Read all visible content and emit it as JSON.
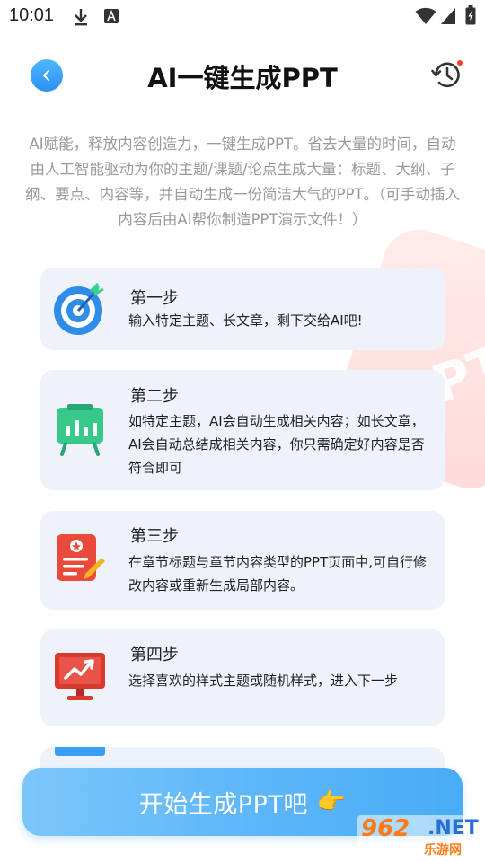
{
  "status_bar": {
    "time": "10:01",
    "download_icon": "download-icon",
    "a_icon": "font-a-icon",
    "wifi_icon": "wifi-icon",
    "signal_icon": "signal-icon",
    "battery_icon": "battery-icon"
  },
  "header": {
    "title": "AI一键生成PPT",
    "back_icon": "chevron-left-icon",
    "history_icon": "history-icon"
  },
  "intro": {
    "text": "AI赋能，释放内容创造力，一键生成PPT。省去大量的时间，自动由人工智能驱动为你的主题/课题/论点生成大量：标题、大纲、子纲、要点、内容等，并自动生成一份简洁大气的PPT。（可手动插入内容后由AI帮你制造PPT演示文件！）"
  },
  "steps": [
    {
      "title": "第一步",
      "desc": "输入特定主题、长文章，剩下交给AI吧!",
      "icon": "target-icon"
    },
    {
      "title": "第二步",
      "desc": "如特定主题，AI会自动生成相关内容；如长文章，AI会自动总结成相关内容，你只需确定好内容是否符合即可",
      "icon": "presentation-board-icon"
    },
    {
      "title": "第三步",
      "desc": "在章节标题与章节内容类型的PPT页面中,可自行修改内容或重新生成局部内容。",
      "icon": "edit-document-icon"
    },
    {
      "title": "第四步",
      "desc": "选择喜欢的样式主题或随机样式，进入下一步",
      "icon": "monitor-chart-icon"
    }
  ],
  "start_button": {
    "label": "开始生成PPT吧",
    "emoji": "👉"
  },
  "watermark": {
    "number": "962",
    "net": ".NET",
    "cn": "乐游网"
  },
  "colors": {
    "accent_blue": "#3a9af5",
    "card_bg": "#eef3fb",
    "intro_text": "#9a9a9a"
  }
}
